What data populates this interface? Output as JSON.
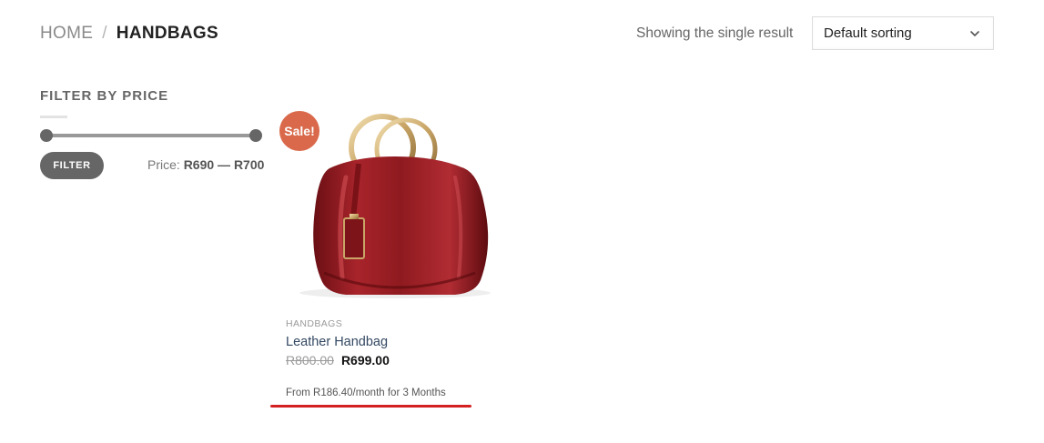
{
  "breadcrumb": {
    "home": "HOME",
    "separator": "/",
    "current": "HANDBAGS"
  },
  "results": {
    "text": "Showing the single result"
  },
  "sorting": {
    "selected": "Default sorting",
    "icon": "chevron-down-icon"
  },
  "filter": {
    "title": "FILTER BY PRICE",
    "button_label": "FILTER",
    "price_label": "Price:",
    "price_min": "R690",
    "price_dash": "—",
    "price_max": "R700"
  },
  "product": {
    "badge": "Sale!",
    "category": "HANDBAGS",
    "name": "Leather Handbag",
    "price_old": "R800.00",
    "price_new": "R699.00",
    "installment": "From R186.40/month for 3 Months"
  },
  "colors": {
    "badge": "#d9694a",
    "link": "#334862",
    "underline": "#d42020",
    "button": "#666666",
    "bag": "#8e1a1f"
  }
}
